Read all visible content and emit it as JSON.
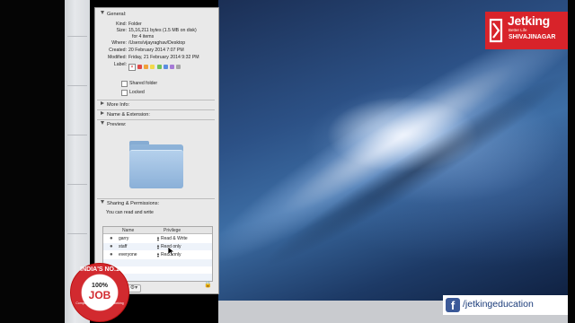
{
  "info_panel": {
    "general": {
      "header": "General:",
      "kind_label": "Kind:",
      "kind": "Folder",
      "size_label": "Size:",
      "size": "15,16,211 bytes (1.5 MB on disk)",
      "size_items": "for 4 items",
      "where_label": "Where:",
      "where": "/Users/vijayraghav/Desktop",
      "created_label": "Created:",
      "created": "20 February 2014 7:07 PM",
      "modified_label": "Modified:",
      "modified": "Friday, 21 February 2014 9:32 PM",
      "label_label": "Label:",
      "label_colors": [
        "#e04b4b",
        "#f0a23a",
        "#f2d94a",
        "#6fc25a",
        "#5a8de0",
        "#a67ad6",
        "#a6a6a6"
      ],
      "shared_folder": "Shared folder",
      "locked": "Locked"
    },
    "more_info": "More Info:",
    "name_extension": "Name & Extension:",
    "preview": "Preview:",
    "sharing": {
      "header": "Sharing & Permissions:",
      "status": "You can read and write",
      "col_name": "Name",
      "col_privilege": "Privilege",
      "rows": [
        {
          "name": "garry",
          "privilege": "Read & Write",
          "icon": "user-icon"
        },
        {
          "name": "staff",
          "privilege": "Read only",
          "icon": "group-icon"
        },
        {
          "name": "everyone",
          "privilege": "Read only",
          "icon": "group-icon"
        }
      ]
    }
  },
  "logo": {
    "name": "Jetking",
    "tagline": "Better Life",
    "city": "SHIVAJINAGAR",
    "color": "#d8232a"
  },
  "badge": {
    "top": "INDIA'S NO.1",
    "pct": "100%",
    "job": "JOB",
    "sub": "Computer Hardware & Networking Institute"
  },
  "facebook": {
    "handle": "/jetkingeducation"
  }
}
